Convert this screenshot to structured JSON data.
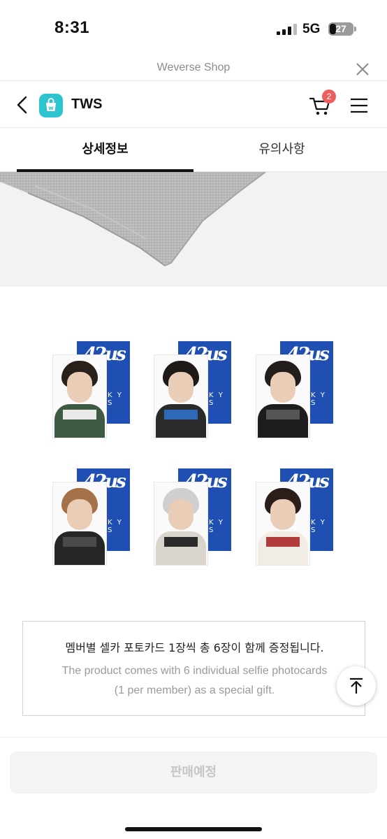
{
  "status_bar": {
    "time": "8:31",
    "network": "5G",
    "battery_level": "27",
    "battery_fraction": 0.27
  },
  "webview": {
    "title": "Weverse Shop",
    "close_icon": "close-icon"
  },
  "header": {
    "back_icon": "chevron-left-icon",
    "logo_icon": "weverse-shop-bag-icon",
    "brand": "TWS",
    "cart_icon": "cart-icon",
    "cart_count": "2",
    "menu_icon": "hamburger-menu-icon"
  },
  "tabs": [
    {
      "label": "상세정보",
      "active": true
    },
    {
      "label": "유의사항",
      "active": false
    }
  ],
  "photocards": {
    "back_tag": "K Y S",
    "count": 6
  },
  "notice": {
    "korean": "멤버별 셀카 포토카드 1장씩 총 6장이 함께 증정됩니다.",
    "english_line1": "The product comes with 6 individual selfie photocards",
    "english_line2": "(1 per member) as a special gift."
  },
  "scroll_top_icon": "arrow-up-to-top-icon",
  "bottom": {
    "button_label": "판매예정"
  },
  "colors": {
    "brand_teal": "#2ec4cf",
    "badge_red": "#ef5e5e",
    "card_blue": "#1f4fb3",
    "disabled_text": "#c6c6c6"
  }
}
